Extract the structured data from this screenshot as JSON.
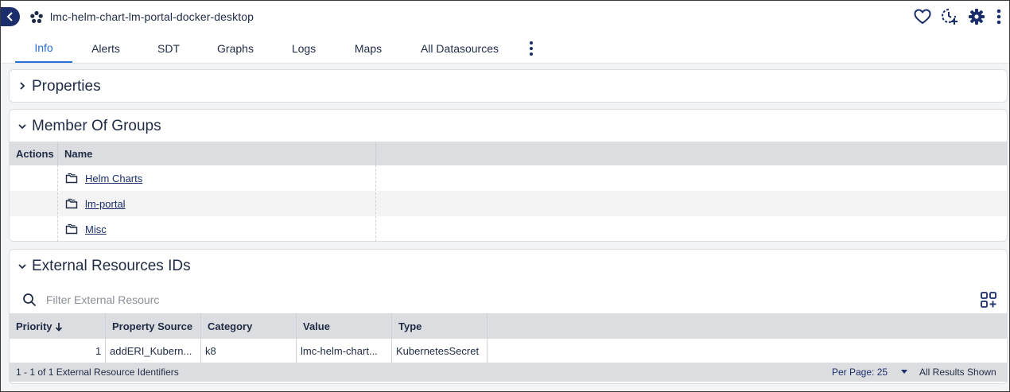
{
  "header": {
    "title": "lmc-helm-chart-lm-portal-docker-desktop",
    "icons": [
      "back-arrow-icon",
      "cluster-icon",
      "heart-icon",
      "sdt-clock-icon",
      "gear-icon",
      "more-vertical-icon"
    ]
  },
  "tabs": [
    {
      "label": "Info",
      "active": true
    },
    {
      "label": "Alerts"
    },
    {
      "label": "SDT"
    },
    {
      "label": "Graphs"
    },
    {
      "label": "Logs"
    },
    {
      "label": "Maps"
    },
    {
      "label": "All Datasources"
    }
  ],
  "properties": {
    "title": "Properties"
  },
  "groups": {
    "title": "Member Of Groups",
    "columns": [
      "Actions",
      "Name"
    ],
    "rows": [
      {
        "name": "Helm Charts"
      },
      {
        "name": "lm-portal"
      },
      {
        "name": "Misc"
      }
    ]
  },
  "external": {
    "title": "External Resources IDs",
    "search_placeholder": "Filter External Resourc",
    "columns": [
      "Priority",
      "Property Source",
      "Category",
      "Value",
      "Type"
    ],
    "rows": [
      {
        "priority": "1",
        "property_source": "addERI_Kubern...",
        "category": "k8",
        "value": "lmc-helm-chart...",
        "type": "KubernetesSecret"
      }
    ],
    "footer": {
      "count_text": "1 - 1 of 1 External Resource Identifiers",
      "per_page": "Per Page: 25",
      "all_results": "All Results Shown"
    }
  },
  "colors": {
    "accent": "#2a6fd6",
    "navy": "#1a2e6b",
    "header_bg": "#dcdde0"
  }
}
